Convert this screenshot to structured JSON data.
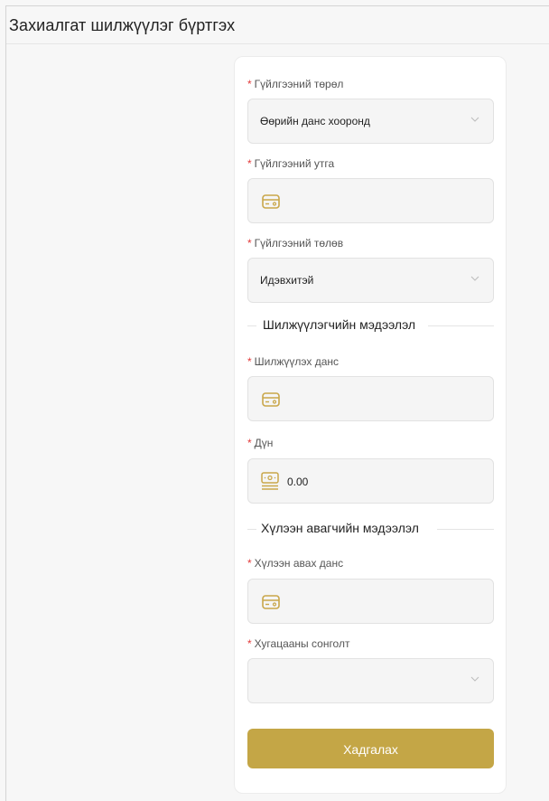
{
  "page": {
    "title": "Захиалгат шилжүүлэг бүртгэх"
  },
  "form": {
    "transaction_type": {
      "label": "Гүйлгээний төрөл",
      "value": "Өөрийн данс хооронд"
    },
    "transaction_description": {
      "label": "Гүйлгээний утга",
      "value": ""
    },
    "transaction_status": {
      "label": "Гүйлгээний төлөв",
      "value": "Идэвхитэй"
    },
    "sender_section": {
      "title": "Шилжүүлэгчийн мэдээлэл"
    },
    "sender_account": {
      "label": "Шилжүүлэх данс",
      "value": ""
    },
    "amount": {
      "label": "Дүн",
      "value": "0.00"
    },
    "receiver_section": {
      "title": "Хүлээн авагчийн мэдээлэл"
    },
    "receiver_account": {
      "label": "Хүлээн авах данс",
      "value": ""
    },
    "period_selection": {
      "label": "Хугацааны сонголт",
      "value": ""
    },
    "required_mark": "*",
    "save_label": "Хадгалах"
  },
  "icons": {
    "account": "credit-card-icon",
    "amount": "money-stack-icon",
    "dropdown": "chevron-down-icon"
  },
  "colors": {
    "accent": "#c4a646",
    "required": "#e23a3a",
    "field_bg": "#f5f5f5"
  }
}
